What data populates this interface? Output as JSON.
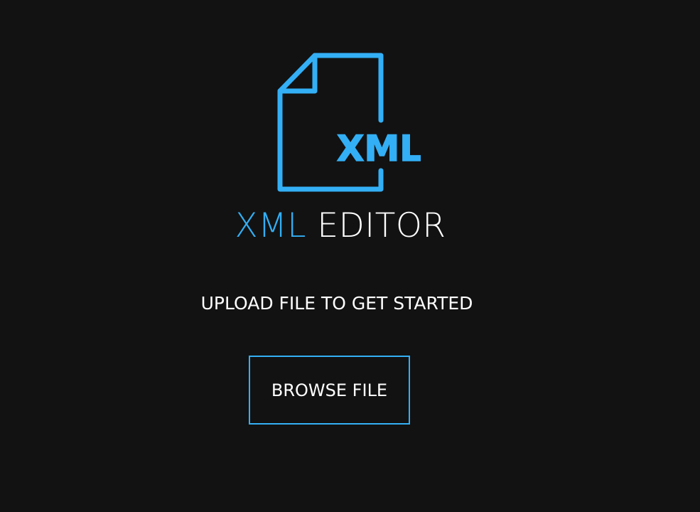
{
  "logo": {
    "icon": "xml-file-icon",
    "badge_text": "XML",
    "color": "#33aff5"
  },
  "title": {
    "accent": "XML",
    "main": "EDITOR"
  },
  "subtitle": "UPLOAD FILE TO GET STARTED",
  "browse_button": {
    "label": "BROWSE FILE",
    "border_color": "#33aff5"
  },
  "colors": {
    "background": "#121212",
    "accent": "#33aff5",
    "text": "#ffffff"
  }
}
